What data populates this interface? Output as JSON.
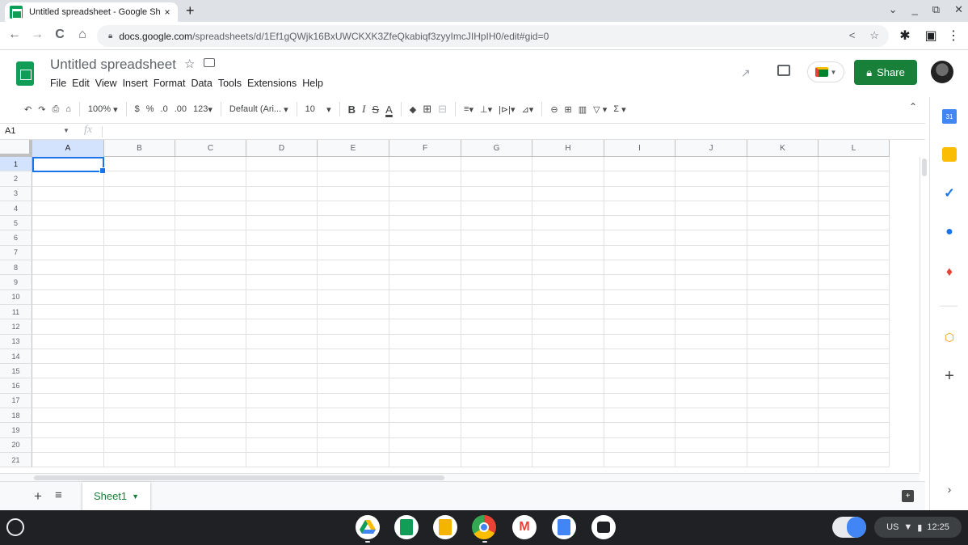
{
  "browser": {
    "tab_title": "Untitled spreadsheet - Google Sh",
    "tab_close": "×",
    "new_tab": "+",
    "window_controls": [
      "⌄",
      "_",
      "⧉",
      "✕"
    ],
    "nav": {
      "back": "←",
      "forward": "→",
      "reload": "C",
      "home": "⌂"
    },
    "url_host": "docs.google.com",
    "url_path": "/spreadsheets/d/1Ef1gQWjk16BxUWCKXK3ZfeQkabiqf3zyyImcJIHpIH0/edit#gid=0",
    "url_actions": [
      "<",
      "☆"
    ],
    "ext_icons": [
      "✱",
      "▣",
      "⋮"
    ]
  },
  "doc": {
    "title": "Untitled spreadsheet",
    "menu": [
      "File",
      "Edit",
      "View",
      "Insert",
      "Format",
      "Data",
      "Tools",
      "Extensions",
      "Help"
    ],
    "share_label": "Share",
    "share_icon": "lock-icon"
  },
  "toolbar": {
    "undo": "↶",
    "redo": "↷",
    "print": "⎙",
    "paint": "⌂",
    "zoom": "100%",
    "currency": "$",
    "percent": "%",
    "dec_decrease": ".0",
    "dec_increase": ".00",
    "more_formats": "123",
    "font": "Default (Ari...",
    "font_size": "10",
    "bold": "B",
    "italic": "I",
    "strike": "S",
    "text_color": "A",
    "fill": "◆",
    "borders": "⊞",
    "merge": "⊟",
    "halign": "≡",
    "valign": "⊥",
    "wrap": "|⊳|",
    "rotate": "⊿",
    "link": "⊖",
    "comment": "⊞",
    "chart": "▥",
    "filter": "▽",
    "functions": "Σ",
    "collapse": "⌃"
  },
  "formula": {
    "cell_ref": "A1",
    "fx": "fx",
    "value": ""
  },
  "grid": {
    "columns": [
      "A",
      "B",
      "C",
      "D",
      "E",
      "F",
      "G",
      "H",
      "I",
      "J",
      "K",
      "L"
    ],
    "rows": [
      "1",
      "2",
      "3",
      "4",
      "5",
      "6",
      "7",
      "8",
      "9",
      "10",
      "11",
      "12",
      "13",
      "14",
      "15",
      "16",
      "17",
      "18",
      "19",
      "20",
      "21"
    ],
    "selected_cell": "A1"
  },
  "sheets": {
    "add": "+",
    "all": "≡",
    "active_tab": "Sheet1",
    "explore": "+"
  },
  "side_panel": [
    "calendar-icon",
    "keep-icon",
    "tasks-icon",
    "contacts-icon",
    "maps-icon",
    "workspace-addon-icon",
    "add-icon",
    "expand-icon"
  ],
  "shelf": {
    "apps": [
      "Google Drive",
      "Google Sheets",
      "Google Slides",
      "Chrome",
      "Gmail",
      "Google Docs",
      "Camera"
    ],
    "locale": "US",
    "time": "12:25"
  },
  "colors": {
    "accent": "#1a73e8",
    "share_green": "#188038",
    "sheet_tab_green": "#188038"
  }
}
